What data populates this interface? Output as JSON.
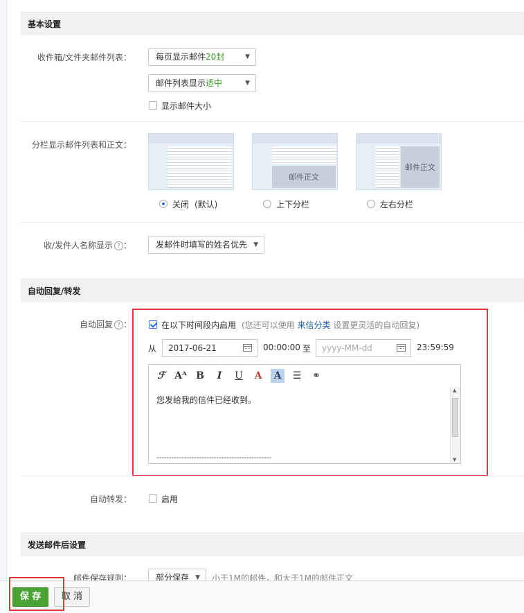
{
  "basic": {
    "title": "基本设置",
    "list_label": "收件箱/文件夹邮件列表：",
    "per_page_prefix": "每页显示邮件",
    "per_page_value": "20封",
    "density_prefix": "邮件列表显示",
    "density_value": "适中",
    "show_size_label": "显示邮件大小",
    "split_label": "分栏显示邮件列表和正文：",
    "split_options": [
      {
        "label": "关闭",
        "note": "(默认)",
        "pane_text": "",
        "selected": true
      },
      {
        "label": "上下分栏",
        "note": "",
        "pane_text": "邮件正文",
        "selected": false
      },
      {
        "label": "左右分栏",
        "note": "",
        "pane_text": "邮件正文",
        "selected": false
      }
    ],
    "name_display_label": "收/发件人名称显示",
    "name_display_value": "发邮件时填写的姓名优先"
  },
  "auto": {
    "title": "自动回复/转发",
    "reply_label": "自动回复",
    "reply_enable_label": "在以下时间段内启用",
    "hint_before": "(您还可以使用",
    "hint_link": "来信分类",
    "hint_after": "设置更灵活的自动回复)",
    "from_label": "从",
    "start_date": "2017-06-21",
    "start_time": "00:00:00",
    "to_label": "至",
    "end_date_placeholder": "yyyy-MM-dd",
    "end_time": "23:59:59",
    "reply_text": "您发给我的信件已经收到。",
    "signature_line": "----------------------------------------------",
    "forward_label": "自动转发：",
    "forward_enable_label": "启用"
  },
  "after_send": {
    "title": "发送邮件后设置",
    "save_rule_label": "邮件保存规则：",
    "save_rule_value": "部分保存",
    "save_rule_hint": "小于1M的邮件，和大于1M的邮件正文"
  },
  "footer": {
    "save_label": "保 存",
    "cancel_label": "取 消"
  },
  "colors": {
    "accent_green": "#4aa236",
    "highlight_red": "#e0353c",
    "link_blue": "#1a5aa6"
  }
}
